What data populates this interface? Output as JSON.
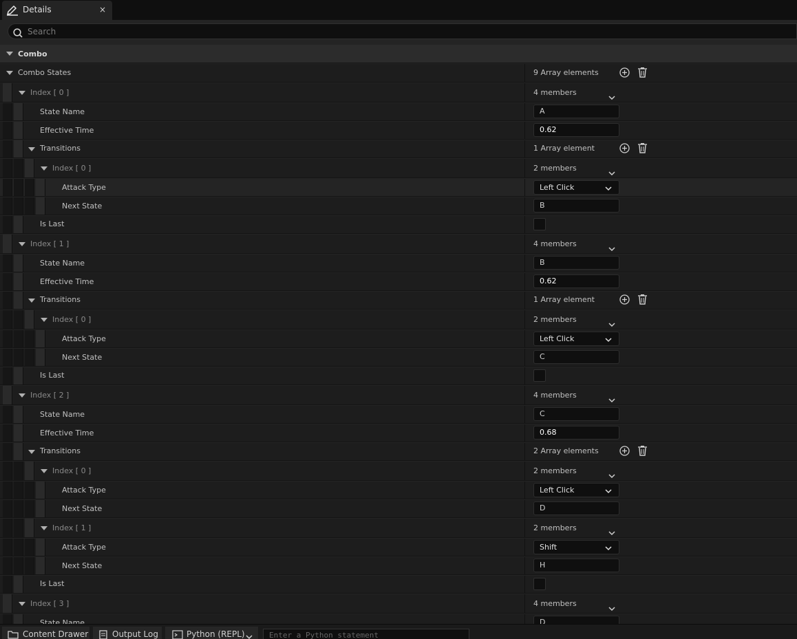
{
  "tab": {
    "title": "Details",
    "close": "×"
  },
  "search": {
    "placeholder": "Search"
  },
  "category": {
    "label": "Combo"
  },
  "combo_states": {
    "label": "Combo States",
    "count": "9 Array elements"
  },
  "states": [
    {
      "index_label": "Index [ 0 ]",
      "members": "4 members",
      "state_name_label": "State Name",
      "state_name": "A",
      "effective_time_label": "Effective Time",
      "effective_time": "0.62",
      "transitions_label": "Transitions",
      "transitions_count": "1 Array element",
      "transitions": [
        {
          "index_label": "Index [ 0 ]",
          "members": "2 members",
          "attack_type_label": "Attack Type",
          "attack_type": "Left Click",
          "next_state_label": "Next State",
          "next_state": "B"
        }
      ],
      "is_last_label": "Is Last",
      "is_last": false
    },
    {
      "index_label": "Index [ 1 ]",
      "members": "4 members",
      "state_name_label": "State Name",
      "state_name": "B",
      "effective_time_label": "Effective Time",
      "effective_time": "0.62",
      "transitions_label": "Transitions",
      "transitions_count": "1 Array element",
      "transitions": [
        {
          "index_label": "Index [ 0 ]",
          "members": "2 members",
          "attack_type_label": "Attack Type",
          "attack_type": "Left Click",
          "next_state_label": "Next State",
          "next_state": "C"
        }
      ],
      "is_last_label": "Is Last",
      "is_last": false
    },
    {
      "index_label": "Index [ 2 ]",
      "members": "4 members",
      "state_name_label": "State Name",
      "state_name": "C",
      "effective_time_label": "Effective Time",
      "effective_time": "0.68",
      "transitions_label": "Transitions",
      "transitions_count": "2 Array elements",
      "transitions": [
        {
          "index_label": "Index [ 0 ]",
          "members": "2 members",
          "attack_type_label": "Attack Type",
          "attack_type": "Left Click",
          "next_state_label": "Next State",
          "next_state": "D"
        },
        {
          "index_label": "Index [ 1 ]",
          "members": "2 members",
          "attack_type_label": "Attack Type",
          "attack_type": "Shift",
          "next_state_label": "Next State",
          "next_state": "H"
        }
      ],
      "is_last_label": "Is Last",
      "is_last": false
    },
    {
      "index_label": "Index [ 3 ]",
      "members": "4 members",
      "state_name_label": "State Name",
      "state_name": "D"
    }
  ],
  "statusbar": {
    "content_drawer": "Content Drawer",
    "output_log": "Output Log",
    "python_mode": "Python (REPL)",
    "python_placeholder": "Enter a Python statement"
  },
  "colors": {
    "panel": "#242424",
    "row": "#1d1d1d",
    "field": "#0f0f0f",
    "text": "#c0c0c0"
  }
}
